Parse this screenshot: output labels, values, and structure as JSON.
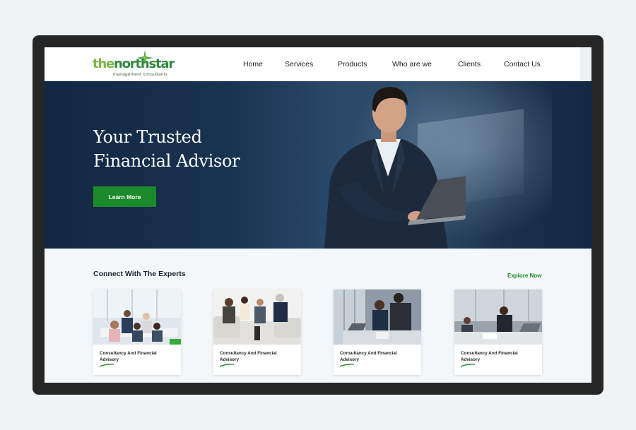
{
  "brand": {
    "word_part1": "the",
    "word_part2": "northstar",
    "subtitle": "management consultants"
  },
  "nav": {
    "items": [
      "Home",
      "Services",
      "Products",
      "Who are we",
      "Clients",
      "Contact Us"
    ]
  },
  "hero": {
    "title_line1": "Your Trusted",
    "title_line2": "Financial Advisor",
    "cta_label": "Learn More"
  },
  "experts": {
    "title": "Connect With The Experts",
    "explore_label": "Explore Now",
    "cards": [
      {
        "label": "Consultancy And Financial Advisory",
        "photo": "team-meeting-photo"
      },
      {
        "label": "Consultancy And Financial Advisory",
        "photo": "lounge-discussion-photo"
      },
      {
        "label": "Consultancy And Financial Advisory",
        "photo": "laptop-review-photo"
      },
      {
        "label": "Consultancy And Financial Advisory",
        "photo": "office-desk-photo"
      }
    ]
  },
  "colors": {
    "accent_green": "#1b8a2a",
    "hero_navy": "#1a3352",
    "frame": "#262626"
  }
}
